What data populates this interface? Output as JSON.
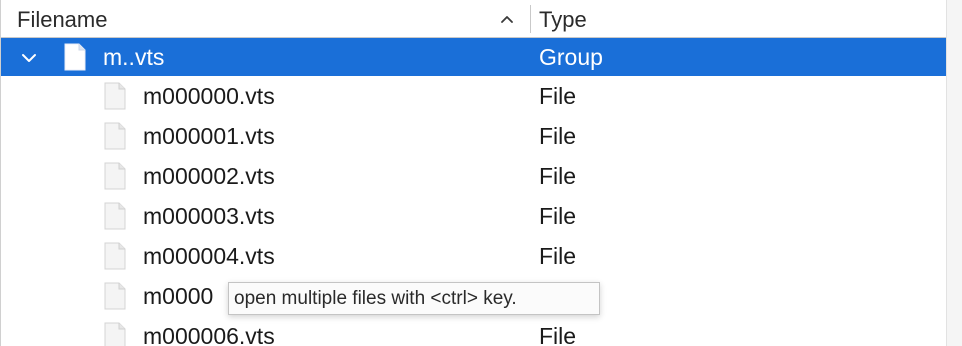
{
  "header": {
    "filename_label": "Filename",
    "type_label": "Type",
    "sort_icon": "chevron-up-icon"
  },
  "group_row": {
    "name": "m..vts",
    "type": "Group",
    "expand_icon": "chevron-down-icon",
    "file_icon": "document-icon"
  },
  "files": [
    {
      "name": "m000000.vts",
      "type": "File"
    },
    {
      "name": "m000001.vts",
      "type": "File"
    },
    {
      "name": "m000002.vts",
      "type": "File"
    },
    {
      "name": "m000003.vts",
      "type": "File"
    },
    {
      "name": "m000004.vts",
      "type": "File"
    },
    {
      "name": "m0000",
      "type": ""
    },
    {
      "name": "m000006.vts",
      "type": "File"
    }
  ],
  "tooltip": {
    "text": "open multiple files with <ctrl> key."
  },
  "colors": {
    "selection": "#1a6fd8",
    "header_text": "#2b2b2b"
  }
}
